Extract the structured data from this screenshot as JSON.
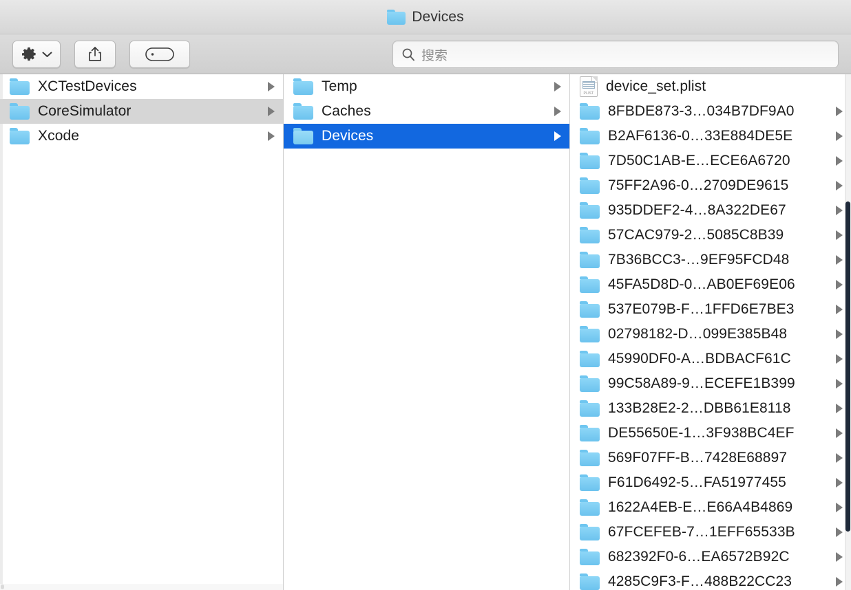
{
  "window": {
    "title": "Devices",
    "title_icon": "folder-icon"
  },
  "toolbar": {
    "action_button": {
      "icon": "gear-icon",
      "chevron": "chevron-down-icon",
      "label": ""
    },
    "share_button": {
      "icon": "share-icon",
      "label": ""
    },
    "tag_button": {
      "icon": "tag-icon",
      "label": ""
    },
    "search": {
      "icon": "search-icon",
      "placeholder": "搜索",
      "value": ""
    }
  },
  "columns": [
    {
      "index": 1,
      "items": [
        {
          "name": "XCTestDevices",
          "icon": "folder-icon",
          "has_arrow": true,
          "state": "normal"
        },
        {
          "name": "CoreSimulator",
          "icon": "folder-icon",
          "has_arrow": true,
          "state": "selected-inactive"
        },
        {
          "name": "Xcode",
          "icon": "folder-icon",
          "has_arrow": true,
          "state": "normal"
        }
      ]
    },
    {
      "index": 2,
      "items": [
        {
          "name": "Temp",
          "icon": "folder-icon",
          "has_arrow": true,
          "state": "normal"
        },
        {
          "name": "Caches",
          "icon": "folder-icon",
          "has_arrow": true,
          "state": "normal"
        },
        {
          "name": "Devices",
          "icon": "folder-icon",
          "has_arrow": true,
          "state": "selected-active"
        }
      ]
    },
    {
      "index": 3,
      "items": [
        {
          "name": "device_set.plist",
          "icon": "plist-file-icon",
          "has_arrow": false,
          "state": "normal"
        },
        {
          "name": "8FBDE873-3…034B7DF9A0",
          "icon": "folder-icon",
          "has_arrow": true,
          "state": "normal"
        },
        {
          "name": "B2AF6136-0…33E884DE5E",
          "icon": "folder-icon",
          "has_arrow": true,
          "state": "normal"
        },
        {
          "name": "7D50C1AB-E…ECE6A6720",
          "icon": "folder-icon",
          "has_arrow": true,
          "state": "normal"
        },
        {
          "name": "75FF2A96-0…2709DE9615",
          "icon": "folder-icon",
          "has_arrow": true,
          "state": "normal"
        },
        {
          "name": "935DDEF2-4…8A322DE67",
          "icon": "folder-icon",
          "has_arrow": true,
          "state": "normal"
        },
        {
          "name": "57CAC979-2…5085C8B39",
          "icon": "folder-icon",
          "has_arrow": true,
          "state": "normal"
        },
        {
          "name": "7B36BCC3-…9EF95FCD48",
          "icon": "folder-icon",
          "has_arrow": true,
          "state": "normal"
        },
        {
          "name": "45FA5D8D-0…AB0EF69E06",
          "icon": "folder-icon",
          "has_arrow": true,
          "state": "normal"
        },
        {
          "name": "537E079B-F…1FFD6E7BE3",
          "icon": "folder-icon",
          "has_arrow": true,
          "state": "normal"
        },
        {
          "name": "02798182-D…099E385B48",
          "icon": "folder-icon",
          "has_arrow": true,
          "state": "normal"
        },
        {
          "name": "45990DF0-A…BDBACF61C",
          "icon": "folder-icon",
          "has_arrow": true,
          "state": "normal"
        },
        {
          "name": "99C58A89-9…ECEFE1B399",
          "icon": "folder-icon",
          "has_arrow": true,
          "state": "normal"
        },
        {
          "name": "133B28E2-2…DBB61E8118",
          "icon": "folder-icon",
          "has_arrow": true,
          "state": "normal"
        },
        {
          "name": "DE55650E-1…3F938BC4EF",
          "icon": "folder-icon",
          "has_arrow": true,
          "state": "normal"
        },
        {
          "name": "569F07FF-B…7428E68897",
          "icon": "folder-icon",
          "has_arrow": true,
          "state": "normal"
        },
        {
          "name": "F61D6492-5…FA51977455",
          "icon": "folder-icon",
          "has_arrow": true,
          "state": "normal"
        },
        {
          "name": "1622A4EB-E…E66A4B4869",
          "icon": "folder-icon",
          "has_arrow": true,
          "state": "normal"
        },
        {
          "name": "67FCEFEB-7…1EFF65533B",
          "icon": "folder-icon",
          "has_arrow": true,
          "state": "normal"
        },
        {
          "name": "682392F0-6…EA6572B92C",
          "icon": "folder-icon",
          "has_arrow": true,
          "state": "normal"
        },
        {
          "name": "4285C9F3-F…488B22CC23",
          "icon": "folder-icon",
          "has_arrow": true,
          "state": "normal"
        }
      ]
    }
  ],
  "colors": {
    "selection_active": "#1268e0",
    "selection_inactive": "#d6d6d6",
    "folder_blue": "#6cc3ee",
    "scrollbar_thumb": "#1f2a3a"
  }
}
